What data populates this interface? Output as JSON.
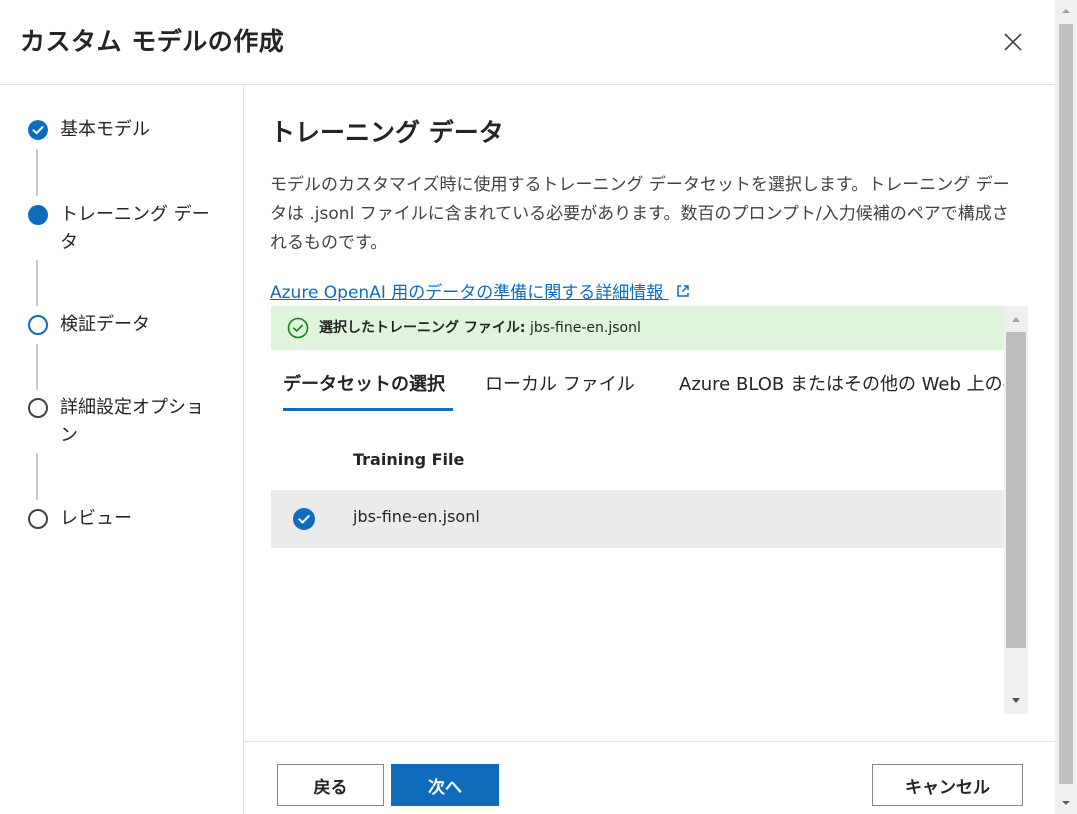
{
  "dialog": {
    "title": "カスタム モデルの作成"
  },
  "steps": [
    {
      "label": "基本モデル",
      "state": "completed"
    },
    {
      "label": "トレーニング データ",
      "state": "current"
    },
    {
      "label": "検証データ",
      "state": "upcoming"
    },
    {
      "label": "詳細設定オプション",
      "state": "pending"
    },
    {
      "label": "レビュー",
      "state": "pending"
    }
  ],
  "main": {
    "title": "トレーニング データ",
    "description": "モデルのカスタマイズ時に使用するトレーニング データセットを選択します。トレーニング データは .jsonl ファイルに含まれている必要があります。数百のプロンプト/入力候補のペアで構成されるものです。",
    "link": "Azure OpenAI 用のデータの準備に関する詳細情報"
  },
  "status": {
    "label": "選択したトレーニング ファイル:",
    "value": "jbs-fine-en.jsonl"
  },
  "tabs": [
    {
      "label": "データセットの選択",
      "active": true
    },
    {
      "label": "ローカル ファイル",
      "active": false
    },
    {
      "label": "Azure BLOB またはその他の Web 上の共有場所",
      "active": false
    }
  ],
  "table": {
    "header": "Training File",
    "rows": [
      {
        "file": "jbs-fine-en.jsonl",
        "selected": true
      }
    ]
  },
  "footer": {
    "back": "戻る",
    "next": "次へ",
    "cancel": "キャンセル"
  },
  "colors": {
    "accent": "#0f6cbd",
    "success_bg": "#dff6dd",
    "success_icon": "#107c10",
    "selected_row": "#ebebeb"
  }
}
